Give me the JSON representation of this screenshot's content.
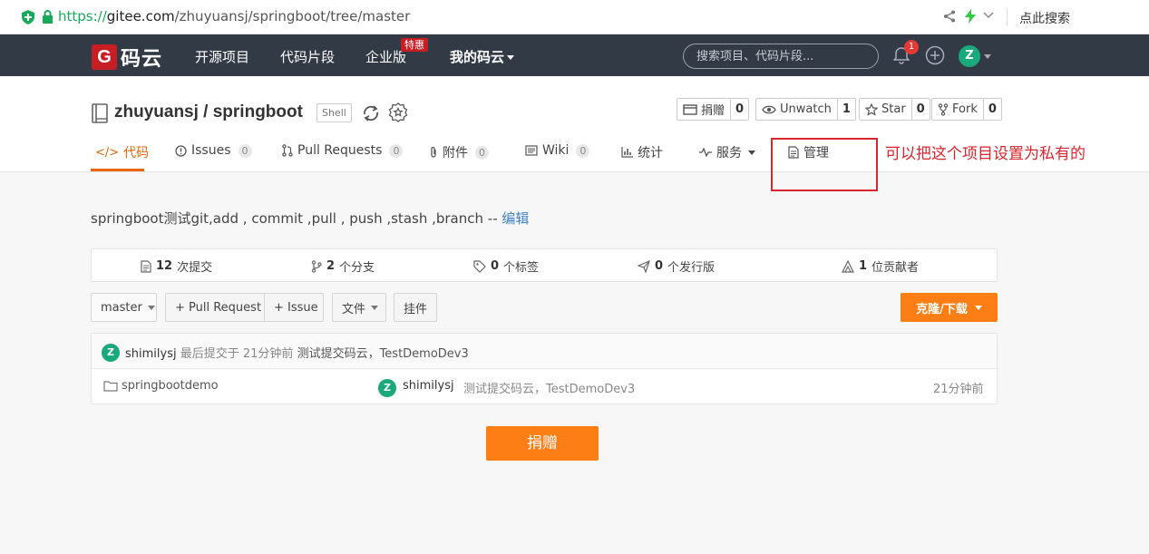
{
  "browser": {
    "url_scheme": "https://",
    "url_host": "gitee.com",
    "url_path": "/zhuyuansj/springboot/tree/master",
    "search_link": "点此搜索"
  },
  "topnav": {
    "logo_letter": "G",
    "logo_text": "码云",
    "items": [
      "开源项目",
      "代码片段",
      "企业版",
      "我的码云"
    ],
    "enterprise_badge": "特惠",
    "search_placeholder": "搜索项目、代码片段...",
    "notification_count": "1",
    "avatar_letter": "Z"
  },
  "project": {
    "title": "zhuyuansj / springboot",
    "language_tag": "Shell",
    "buttons": [
      {
        "label": "捐赠",
        "count": "0"
      },
      {
        "label": "Unwatch",
        "count": "1"
      },
      {
        "label": "Star",
        "count": "0"
      },
      {
        "label": "Fork",
        "count": "0"
      }
    ],
    "tabs": [
      {
        "label": "代码"
      },
      {
        "label": "Issues",
        "count": "0"
      },
      {
        "label": "Pull Requests",
        "count": "0"
      },
      {
        "label": "附件",
        "count": "0"
      },
      {
        "label": "Wiki",
        "count": "0"
      },
      {
        "label": "统计"
      },
      {
        "label": "服务"
      },
      {
        "label": "管理"
      }
    ],
    "annotation": "可以把这个项目设置为私有的",
    "description": "springboot测试git,add , commit ,pull , push ,stash ,branch -- ",
    "edit_link": "编辑"
  },
  "stats": [
    {
      "num": "12",
      "label": "次提交"
    },
    {
      "num": "2",
      "label": "个分支"
    },
    {
      "num": "0",
      "label": "个标签"
    },
    {
      "num": "0",
      "label": "个发行版"
    },
    {
      "num": "1",
      "label": "位贡献者"
    }
  ],
  "toolbar": {
    "branch": "master",
    "pull_request": "+ Pull Request",
    "issue": "+ Issue",
    "file": "文件",
    "attach": "挂件",
    "clone": "克隆/下载"
  },
  "commit": {
    "avatar_letter": "Z",
    "author": "shimilysj",
    "time_text": "最后提交于 21分钟前",
    "message": "测试提交码云，TestDemoDev3"
  },
  "files": [
    {
      "name": "springbootdemo",
      "avatar_letter": "Z",
      "author": "shimilysj",
      "message": "测试提交码云，TestDemoDev3",
      "time": "21分钟前"
    }
  ],
  "donate_button": "捐赠",
  "colors": {
    "accent": "#fd7e14",
    "nav_bg": "#323a46",
    "annotation_red": "#d9262e",
    "link": "#4183c4"
  }
}
